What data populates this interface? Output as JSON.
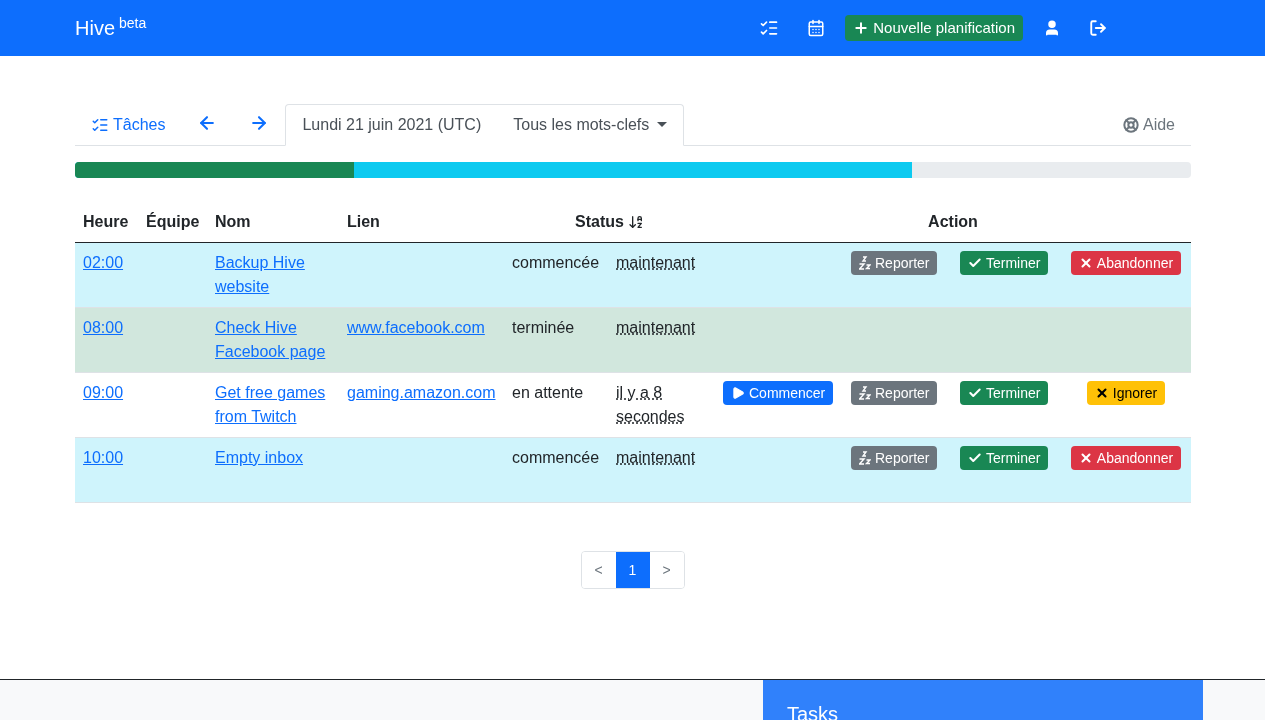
{
  "navbar": {
    "brand": "Hive",
    "badge": "beta",
    "new_button": "Nouvelle planification"
  },
  "tabs": {
    "tasks_link": "Tâches",
    "date_tab": {
      "label": "Lundi 21 juin 2021 (UTC)",
      "selected": true
    },
    "keyword_filter": "Tous les mots-clefs",
    "help": "Aide"
  },
  "progress": [
    {
      "kind": "done",
      "level": 0.25
    },
    {
      "kind": "started",
      "level": 0.75
    }
  ],
  "table": {
    "columns": [
      "Heure",
      "Équipe",
      "Nom",
      "Lien",
      "Status",
      "Action"
    ],
    "rows": [
      {
        "kind": "started",
        "time": "02:00",
        "name": "Backup Hive website",
        "link": "",
        "status": "commencée",
        "when": "maintenant",
        "actions": [
          {
            "kind": "postpone",
            "label": "Reporter"
          },
          {
            "kind": "finish",
            "label": "Terminer"
          },
          {
            "kind": "abandon",
            "label": "Abandonner"
          }
        ]
      },
      {
        "kind": "done",
        "time": "08:00",
        "name": "Check Hive Facebook page",
        "link": "www.facebook.com",
        "status": "terminée",
        "when": "maintenant",
        "actions": []
      },
      {
        "kind": "pending",
        "time": "09:00",
        "name": "Get free games from Twitch",
        "link": "gaming.amazon.com",
        "status": "en attente",
        "when": "il y a 8 secondes",
        "actions": [
          {
            "kind": "start",
            "label": "Commencer"
          },
          {
            "kind": "postpone",
            "label": "Reporter"
          },
          {
            "kind": "finish",
            "label": "Terminer"
          },
          {
            "kind": "ignore",
            "label": "Ignorer"
          }
        ]
      },
      {
        "kind": "started",
        "time": "10:00",
        "name": "Empty inbox",
        "link": "",
        "status": "commencée",
        "when": "maintenant",
        "actions": [
          {
            "kind": "postpone",
            "label": "Reporter"
          },
          {
            "kind": "finish",
            "label": "Terminer"
          },
          {
            "kind": "abandon",
            "label": "Abandonner"
          }
        ]
      }
    ]
  },
  "pagination": [
    {
      "label": "<",
      "selected": false
    },
    {
      "label": "1",
      "selected": true
    },
    {
      "label": ">",
      "selected": false
    }
  ],
  "footer": {
    "title": "Tasks"
  }
}
